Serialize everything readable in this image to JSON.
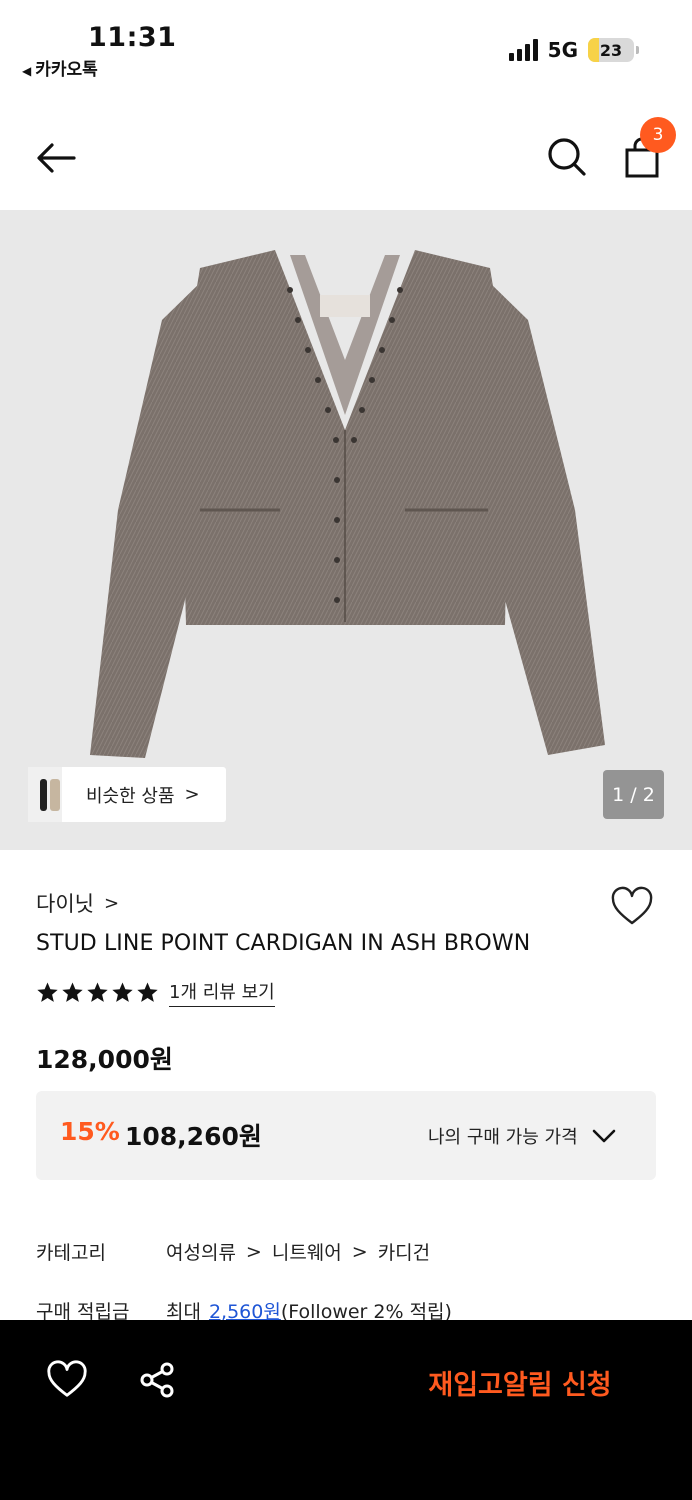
{
  "status_bar": {
    "time": "11:31",
    "back_app": "카카오톡",
    "network": "5G",
    "battery": "23",
    "battery_level": 0.23
  },
  "header": {
    "cart_count": "3"
  },
  "gallery": {
    "similar_label": "비슷한 상품",
    "similar_chevron": ">",
    "page_indicator": "1 / 2"
  },
  "product": {
    "brand": "다이닛",
    "brand_chevron": ">",
    "name": "STUD LINE POINT CARDIGAN IN ASH BROWN",
    "rating": 5,
    "review_link": "1개 리뷰 보기",
    "original_price": "128,000원",
    "discount": "15%",
    "sale_price": "108,260원",
    "my_price_label": "나의 구매 가능 가격"
  },
  "specs": {
    "category_label": "카테고리",
    "categories": [
      "여성의류",
      "니트웨어",
      "카디건"
    ],
    "points_label": "구매 적립금",
    "points_prefix": "최대",
    "points_amount": "2,560원",
    "points_suffix": "(Follower 2% 적립)"
  },
  "bottom_bar": {
    "restock_label": "재입고알림 신청"
  },
  "colors": {
    "accent": "#ff5a1f",
    "link": "#1f56d6",
    "image_bg": "#e8e8e8",
    "bottom_bar": "#000000"
  },
  "icons": [
    "back-arrow-icon",
    "search-icon",
    "shopping-bag-icon",
    "heart-icon",
    "star-icon",
    "chevron-down-icon",
    "share-icon"
  ]
}
